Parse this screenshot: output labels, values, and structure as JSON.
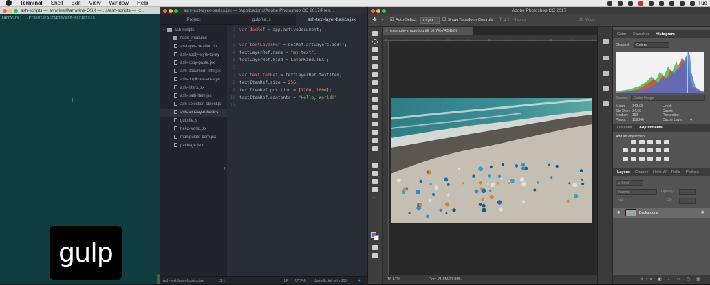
{
  "menubar": {
    "items": [
      "Terminal",
      "Shell",
      "Edit",
      "View",
      "Window",
      "Help"
    ],
    "clock": "Tue"
  },
  "terminal": {
    "title": "ash-scripts — arnwine@arnwine-OSX — ..s/ash-scripts — -z...",
    "prompt": "[arnwine:...Presets/Scripts/ash-scripts]$",
    "logo_text": "gulp"
  },
  "atom": {
    "title": "ash-text-layer-basics.jsx — /Applications/Adobe Photoshop CC 2017/Pres...",
    "tabs": [
      "Project",
      "gulpfile.js",
      "ash-text-layer-basics.jsx"
    ],
    "tree": {
      "root": "ash-scripts",
      "items": [
        "node_modules",
        "art-layer-creation.jsx",
        "ash-apply-style-to-lay",
        "ash-copy-paste.jsx",
        "ash-document-info.jsx",
        "ash-duplicate-art-laye",
        "ash-filters.jsx",
        "ash-path-item.jsx",
        "ash-selection-object.js",
        "ash-text-layer-basics.",
        "gulpfile.js",
        "hello-world.jsx",
        "manipulate-dom.jsx",
        "package.json"
      ]
    },
    "code": {
      "line_numbers": [
        "1",
        "2",
        "3",
        "4",
        "5",
        "6",
        "7",
        "8",
        "9",
        "10",
        "11"
      ],
      "l1_kw": "var",
      "l1_var": "docRef",
      "l1_rest": " = app.activeDocument;",
      "l3_kw": "var",
      "l3_var": "textLayerRef",
      "l3_rest": " = docRef.artLayers.add();",
      "l4_pre": "textLayerRef.name = ",
      "l4_str": "\"my text\"",
      "l4_end": ";",
      "l5": "textLayerRef.kind = LayerKind.TEXT;",
      "l7_kw": "var",
      "l7_var": "textItemRef",
      "l7_rest": " = textLayerRef.textItem;",
      "l8_pre": "textItemRef.size = ",
      "l8_num": "256",
      "l8_end": ";",
      "l9_pre": "textItemRef.position = [",
      "l9_num1": "1200",
      "l9_sep": ", ",
      "l9_num2": "1000",
      "l9_end": "];",
      "l10_pre": "textItemRef.contents = ",
      "l10_str": "\"Hello, World!\"",
      "l10_end": ";"
    },
    "status": {
      "file": "ash-text-layer-basics.jsx",
      "cursor": "11:1",
      "eol": "LF",
      "encoding": "UTF-8",
      "grammar": "JavaScript with JSX"
    }
  },
  "photoshop": {
    "title": "Adobe Photoshop CC 2017",
    "options": {
      "auto_select": "Auto-Select:",
      "layer": "Layer",
      "show_transform": "Show Transform Controls",
      "mode3d": "3D Mode:"
    },
    "document_tab": "example-image.jpg @ 16.7% (RGB/8)",
    "status": {
      "zoom": "16.67%",
      "doc": "Doc: 21.8M/21.8M"
    },
    "panels": {
      "histogram_tabs": [
        "Color",
        "Swatches",
        "Histogram"
      ],
      "channel_label": "Channel:",
      "channel_value": "Colors",
      "source_label": "Source:",
      "source_value": "Entire Image",
      "stats_left": [
        [
          "Mean:",
          "143.98"
        ],
        [
          "Std Dev:",
          "34.60"
        ],
        [
          "Median:",
          "153"
        ],
        [
          "Pixels:",
          "119040"
        ]
      ],
      "stats_right": [
        [
          "Level:",
          ""
        ],
        [
          "Count:",
          ""
        ],
        [
          "Percentile:",
          ""
        ],
        [
          "Cache Level:",
          "4"
        ]
      ],
      "adjust_tabs": [
        "Libraries",
        "Adjustments"
      ],
      "add_adjustment": "Add an adjustment",
      "layers_tabs": [
        "Layers",
        "Channe",
        "Hello W",
        "Trello",
        "Paths A"
      ],
      "kind": "Kind",
      "blend": "Normal",
      "opacity_label": "Opacity:",
      "lock_label": "Lock:",
      "fill_label": "Fill:",
      "layer_name": "Background"
    }
  }
}
